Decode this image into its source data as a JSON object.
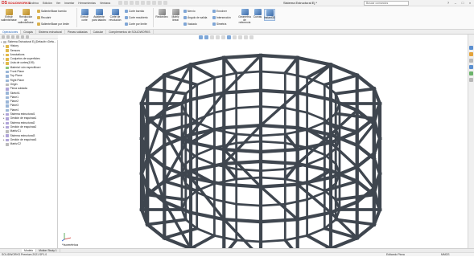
{
  "app": {
    "logo_text": "SOLIDWORKS",
    "doc_title": "Sistema Estructural Ej *"
  },
  "menus": [
    "Archivo",
    "Edición",
    "Ver",
    "Insertar",
    "Herramientas",
    "Ventana"
  ],
  "search": {
    "placeholder": "Buscar comandos"
  },
  "ribbon": {
    "extruir": "Extruir saliente/base",
    "revolucion": "Revolución de saliente/base",
    "barrido": "Saliente/Base barrido",
    "recubrir": "Recubrir",
    "barrido_limite": "Saliente/Base por límite",
    "extruir_corte": "Extruir corte",
    "asistente": "Asistente para taladro",
    "corte_revolucion": "Corte de revolución",
    "corte_barrido": "Corte barrido",
    "corte_recubierto": "Corte recubierto",
    "corte_limite": "Corte por límite",
    "redondeo": "Redondeo",
    "matriz": "Matriz lineal",
    "nervio": "Nervio",
    "angulo": "Ángulo de salida",
    "vaciado": "Vaciado",
    "envolver": "Envolver",
    "interseccion": "Intersección",
    "simetria": "Simetría",
    "geometria": "Geometría de referencia",
    "curvas": "Curvas",
    "instant3d": "Instant3D"
  },
  "tabs": [
    "Operaciones",
    "Croquis",
    "Sistema estructural",
    "Piezas soldadas",
    "Calcular",
    "Complementos de SOLIDWORKS"
  ],
  "tree": [
    {
      "label": "Sistema Estructural Ej  (Default<<Defa...",
      "icon": "part",
      "indent": 0,
      "arrow": true
    },
    {
      "label": "History",
      "icon": "folder",
      "indent": 1,
      "arrow": true
    },
    {
      "label": "Sensors",
      "icon": "folder",
      "indent": 1,
      "arrow": false
    },
    {
      "label": "Annotations",
      "icon": "folder",
      "indent": 1,
      "arrow": true
    },
    {
      "label": "Conjuntos de superficies",
      "icon": "folder",
      "indent": 1,
      "arrow": true
    },
    {
      "label": "Lista de cortes(109)",
      "icon": "folder",
      "indent": 1,
      "arrow": true
    },
    {
      "label": "Material <sin especificar>",
      "icon": "material",
      "indent": 1,
      "arrow": false
    },
    {
      "label": "Front Plane",
      "icon": "plane",
      "indent": 1,
      "arrow": false
    },
    {
      "label": "Top Plane",
      "icon": "plane",
      "indent": 1,
      "arrow": false
    },
    {
      "label": "Right Plane",
      "icon": "plane",
      "indent": 1,
      "arrow": false
    },
    {
      "label": "Origin",
      "icon": "origin",
      "indent": 1,
      "arrow": false
    },
    {
      "label": "Pieza soldada",
      "icon": "weld",
      "indent": 1,
      "arrow": false
    },
    {
      "label": "Sketch1",
      "icon": "sketch",
      "indent": 1,
      "arrow": false
    },
    {
      "label": "Plane1",
      "icon": "plane",
      "indent": 1,
      "arrow": false
    },
    {
      "label": "Plane2",
      "icon": "plane",
      "indent": 1,
      "arrow": false
    },
    {
      "label": "Plane3",
      "icon": "plane",
      "indent": 1,
      "arrow": false
    },
    {
      "label": "Plane4",
      "icon": "plane",
      "indent": 1,
      "arrow": false
    },
    {
      "label": "Sistema estructural1",
      "icon": "structure",
      "indent": 1,
      "arrow": true
    },
    {
      "label": "Gestión de esquinas1",
      "icon": "corner",
      "indent": 1,
      "arrow": true
    },
    {
      "label": "Sistema estructural2",
      "icon": "structure",
      "indent": 1,
      "arrow": true
    },
    {
      "label": "Gestión de esquinas2",
      "icon": "corner",
      "indent": 1,
      "arrow": true
    },
    {
      "label": "MatrizC1",
      "icon": "pattern",
      "indent": 1,
      "arrow": false
    },
    {
      "label": "Sistema estructural3",
      "icon": "structure",
      "indent": 1,
      "arrow": true
    },
    {
      "label": "Gestión de esquinas3",
      "icon": "corner",
      "indent": 1,
      "arrow": true
    },
    {
      "label": "MatrizC2",
      "icon": "pattern",
      "indent": 1,
      "arrow": false
    }
  ],
  "viewport": {
    "view_label": "*Isométrica"
  },
  "bottom_tabs": [
    "Modelo",
    "Motion Study 1"
  ],
  "status": {
    "left": "SOLIDWORKS Premium 2021 SP1.0",
    "mid": "Editando Pieza",
    "units": "MMGS"
  },
  "structure": {
    "member_color": "#3f464f"
  }
}
